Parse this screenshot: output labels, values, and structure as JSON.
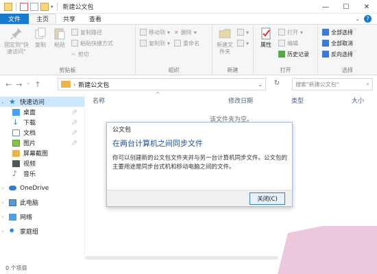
{
  "window": {
    "title": "新建公文包"
  },
  "tabs": [
    {
      "label": "文件"
    },
    {
      "label": "主页"
    },
    {
      "label": "共享"
    },
    {
      "label": "查看"
    }
  ],
  "ribbon": {
    "clipboard": {
      "pin_label": "固定到\"快速访问\"",
      "copy_label": "复制",
      "paste_label": "粘贴",
      "copy_path": "复制路径",
      "paste_shortcut": "粘贴快捷方式",
      "cut": "剪切",
      "group": "剪贴板"
    },
    "organize": {
      "move_to": "移动到",
      "copy_to": "复制到",
      "delete": "删除",
      "rename": "重命名",
      "group": "组织"
    },
    "new": {
      "new_folder": "新建文件夹",
      "group": "新建"
    },
    "open": {
      "properties": "属性",
      "open": "打开",
      "edit": "编辑",
      "history": "历史记录",
      "group": "打开"
    },
    "select": {
      "select_all": "全部选择",
      "select_none": "全部取消",
      "invert": "反向选择",
      "group": "选择"
    }
  },
  "address": {
    "path": "新建公文包",
    "search_placeholder": "搜索\"新建公文包\""
  },
  "sidebar": {
    "items": [
      {
        "label": "快速访问"
      },
      {
        "label": "桌面"
      },
      {
        "label": "下载"
      },
      {
        "label": "文档"
      },
      {
        "label": "图片"
      },
      {
        "label": "屏幕截图"
      },
      {
        "label": "视频"
      },
      {
        "label": "音乐"
      },
      {
        "label": "OneDrive"
      },
      {
        "label": "此电脑"
      },
      {
        "label": "网络"
      },
      {
        "label": "家庭组"
      }
    ]
  },
  "columns": {
    "name": "名称",
    "modified": "修改日期",
    "type": "类型",
    "size": "大小"
  },
  "content": {
    "empty_message": "该文件夹为空。"
  },
  "dialog": {
    "title": "公文包",
    "heading": "在两台计算机之间同步文件",
    "body": "你可以创建新的公文包文件夹并与另一台计算机同步文件。公文包的主要用途是同步台式机和移动电脑之间的文件。",
    "close_button": "关闭(C)"
  },
  "status": {
    "items_count": "0 个项目"
  },
  "colors": {
    "accent": "#1979ca",
    "dialog_heading": "#1f4e9b"
  }
}
